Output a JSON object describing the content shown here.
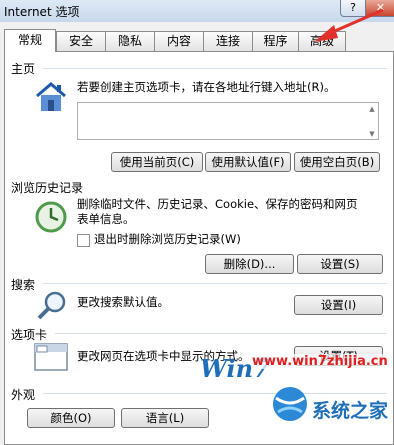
{
  "window": {
    "title": "Internet 选项",
    "help_label": "?",
    "close_label": "✕"
  },
  "tabs": [
    {
      "label": "常规",
      "active": true
    },
    {
      "label": "安全"
    },
    {
      "label": "隐私"
    },
    {
      "label": "内容"
    },
    {
      "label": "连接"
    },
    {
      "label": "程序"
    },
    {
      "label": "高级"
    }
  ],
  "homepage": {
    "group_label": "主页",
    "description": "若要创建主页选项卡，请在各地址行键入地址(R)。",
    "address_value": "",
    "use_current_label": "使用当前页(C)",
    "use_default_label": "使用默认值(F)",
    "use_blank_label": "使用空白页(B)"
  },
  "history": {
    "group_label": "浏览历史记录",
    "description_line1": "删除临时文件、历史记录、Cookie、保存的密码和网页",
    "description_line2": "表单信息。",
    "delete_on_exit_label": "退出时删除浏览历史记录(W)",
    "delete_on_exit_checked": false,
    "delete_label": "删除(D)...",
    "settings_label": "设置(S)"
  },
  "search": {
    "group_label": "搜索",
    "description": "更改搜索默认值。",
    "settings_label": "设置(I)"
  },
  "tabbed": {
    "group_label": "选项卡",
    "description": "更改网页在选项卡中显示的方式。",
    "settings_label": "设置(T)"
  },
  "appearance": {
    "group_label": "外观",
    "colors_label": "颜色(O)",
    "languages_label": "语言(L)"
  },
  "watermark": {
    "site_text": "www.win7zhijia.cn",
    "brand_text": "系统之家"
  },
  "colors": {
    "arrow": "#e0322a",
    "watermark_red": "#e02020",
    "watermark_blue": "#1f6fb8"
  }
}
